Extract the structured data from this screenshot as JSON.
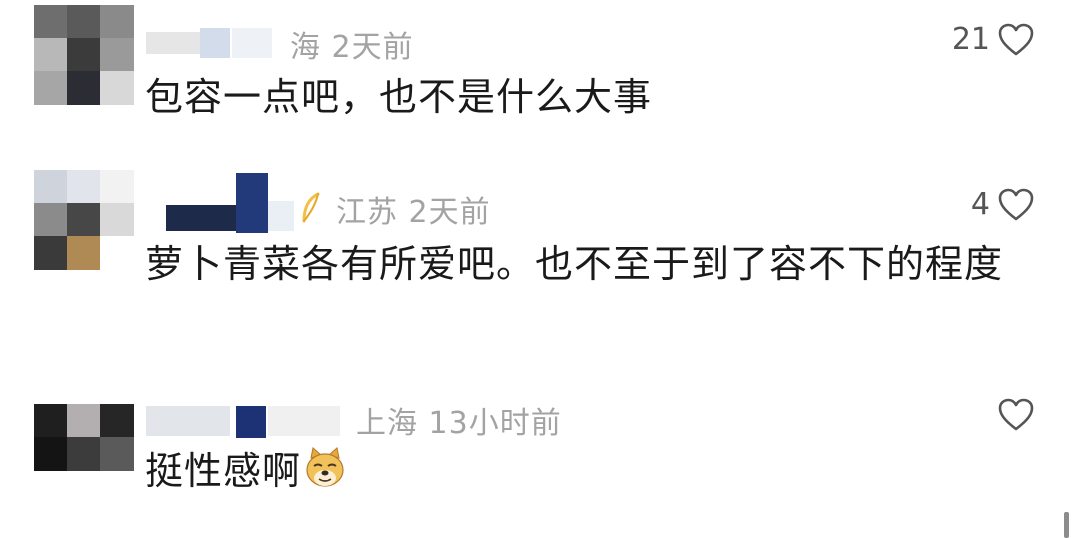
{
  "comments": [
    {
      "location_time": "海 2天前",
      "text": "包容一点吧，也不是什么大事",
      "likes": "21"
    },
    {
      "location_time": "江苏 2天前",
      "text": "萝卜青菜各有所爱吧。也不至于到了容不下的程度",
      "likes": "4"
    },
    {
      "location_time": "上海 13小时前",
      "text": "挺性感啊",
      "likes": ""
    }
  ],
  "icons": {
    "like": "heart-outline-icon",
    "emoji": "doge-emoji-icon",
    "badge": "feather-badge-icon"
  },
  "colors": {
    "meta": "#a3a3a3",
    "text": "#1a1a1a",
    "heart": "#555555"
  }
}
